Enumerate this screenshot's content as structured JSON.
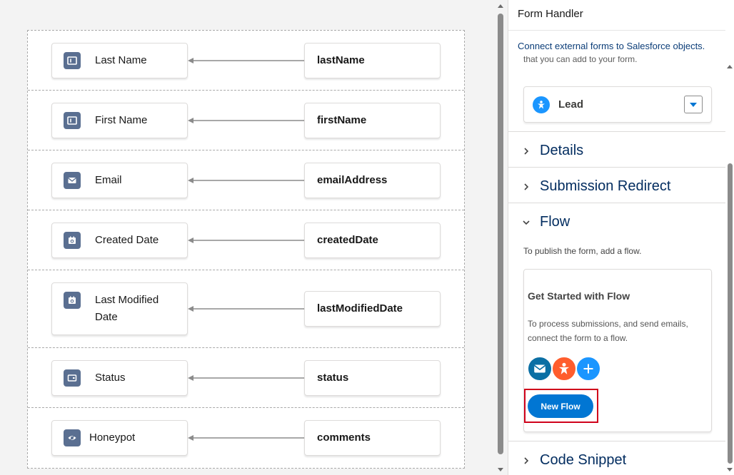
{
  "mappings": [
    {
      "field": "Last Name",
      "icon": "text-field-icon",
      "source": "lastName"
    },
    {
      "field": "First Name",
      "icon": "text-field-icon",
      "source": "firstName"
    },
    {
      "field": "Email",
      "icon": "email-icon",
      "source": "emailAddress"
    },
    {
      "field": "Created Date",
      "icon": "date-icon",
      "source": "createdDate"
    },
    {
      "field": "Last Modified Date",
      "icon": "date-icon",
      "source": "lastModifiedDate"
    },
    {
      "field": "Status",
      "icon": "picklist-icon",
      "source": "status"
    },
    {
      "field": "Honeypot",
      "icon": "hidden-icon",
      "source": "comments"
    }
  ],
  "panel": {
    "title": "Form Handler",
    "description": "Connect external forms to Salesforce objects.",
    "cut_text": "that you can add to your form.",
    "object": {
      "label": "Lead",
      "icon": "lead-icon"
    },
    "sections": {
      "details": "Details",
      "redirect": "Submission Redirect",
      "flow": "Flow",
      "code": "Code Snippet"
    },
    "flow": {
      "description": "To publish the form, add a flow.",
      "card_title": "Get Started with Flow",
      "card_body": "To process submissions, and send emails, connect the form to a flow.",
      "icons": [
        "email-icon",
        "lead-icon",
        "add-icon"
      ],
      "button_label": "New Flow"
    }
  },
  "colors": {
    "brand_blue": "#0176d3",
    "field_icon": "#5a6f91",
    "highlight_outline": "#d0021b",
    "email_circle": "#0b6fa4",
    "lead_circle": "#ff5d2d",
    "add_circle": "#1b96ff"
  }
}
